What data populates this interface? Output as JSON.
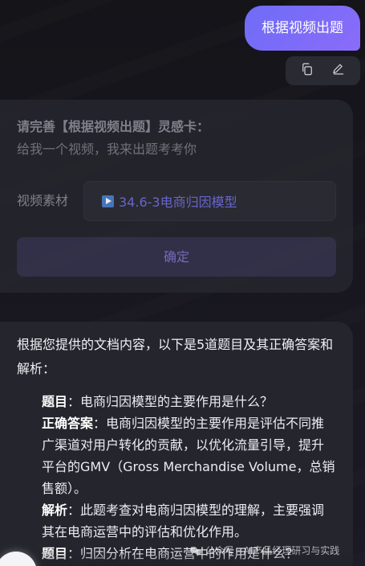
{
  "user_message": {
    "text": "根据视频出题"
  },
  "message_actions": {
    "copy_icon": "copy-icon",
    "edit_icon": "edit-icon"
  },
  "inspiration_card": {
    "title": "请完善【根据视频出题】灵感卡：",
    "subtitle": "给我一个视频，我来出题考考你",
    "field_label": "视频素材",
    "video_icon": "video-file-icon",
    "video_name": "34.6-3电商归因模型",
    "confirm_label": "确定"
  },
  "answer": {
    "intro": "根据您提供的文档内容，以下是5道题目及其正确答案和解析：",
    "items": [
      {
        "q_label": "题目",
        "question": "：电商归因模型的主要作用是什么？",
        "a_label": "正确答案",
        "answer": "：电商归因模型的主要作用是评估不同推广渠道对用户转化的贡献，以优化流量引导，提升平台的GMV（Gross Merchandise Volume，总销售额）。",
        "e_label": "解析",
        "explanation": "：此题考查对电商归因模型的理解，主要强调其在电商运营中的评估和优化作用。"
      },
      {
        "q_label": "题目",
        "question": "：归因分析在电商运营中的作用是什么？"
      }
    ]
  },
  "watermark": {
    "text": "公众号 · AI产品经理研习与实践",
    "icon": "wechat-icon"
  },
  "colors": {
    "background": "#17171c",
    "card": "#25252d",
    "accent": "#6e6cf7",
    "confirm_button": "#35334c"
  }
}
